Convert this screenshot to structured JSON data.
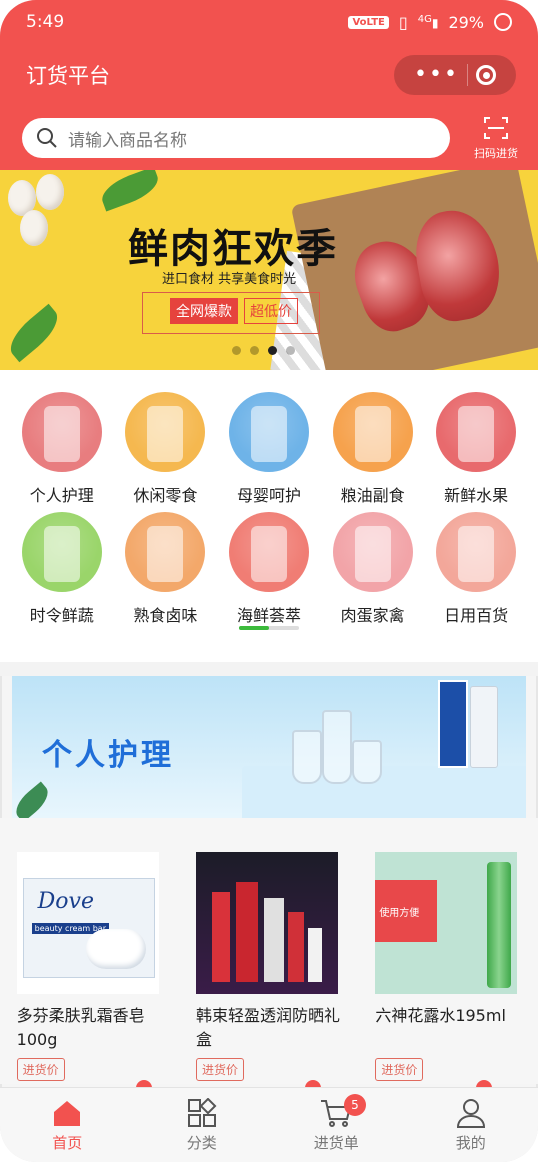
{
  "status_bar": {
    "time": "5:49",
    "volte": "VoLTE",
    "signal": "4G",
    "battery": "29%"
  },
  "header": {
    "title": "订货平台"
  },
  "search": {
    "placeholder": "请输入商品名称",
    "scan_label": "扫码进货"
  },
  "banner": {
    "title": "鲜肉狂欢季",
    "subtitle": "进口食材 共享美食时光",
    "tag1": "全网爆款",
    "tag2": "超低价"
  },
  "categories": [
    {
      "label": "个人护理",
      "color": "#e87d7f"
    },
    {
      "label": "休闲零食",
      "color": "#f5b84f"
    },
    {
      "label": "母婴呵护",
      "color": "#6eb3e8"
    },
    {
      "label": "粮油副食",
      "color": "#f6a24d"
    },
    {
      "label": "新鲜水果",
      "color": "#e86a6d"
    },
    {
      "label": "时令鲜蔬",
      "color": "#9ad56a"
    },
    {
      "label": "熟食卤味",
      "color": "#f3a86a"
    },
    {
      "label": "海鲜荟萃",
      "color": "#f07d74"
    },
    {
      "label": "肉蛋家禽",
      "color": "#f2a4a8"
    },
    {
      "label": "日用百货",
      "color": "#f3a79a"
    }
  ],
  "section": {
    "title": "个人护理"
  },
  "products": [
    {
      "name": "多芬柔肤乳霜香皂100g",
      "price_label": "进货价"
    },
    {
      "name": "韩束轻盈透润防晒礼盒",
      "price_label": "进货价"
    },
    {
      "name": "六神花露水195ml",
      "price_label": "进货价"
    }
  ],
  "product_images": {
    "dove_text": "Dove",
    "dove_sub": "beauty cream bar",
    "green_text": "使用方便"
  },
  "tabbar": {
    "home": "首页",
    "category": "分类",
    "cart": "进货单",
    "cart_badge": "5",
    "mine": "我的"
  }
}
